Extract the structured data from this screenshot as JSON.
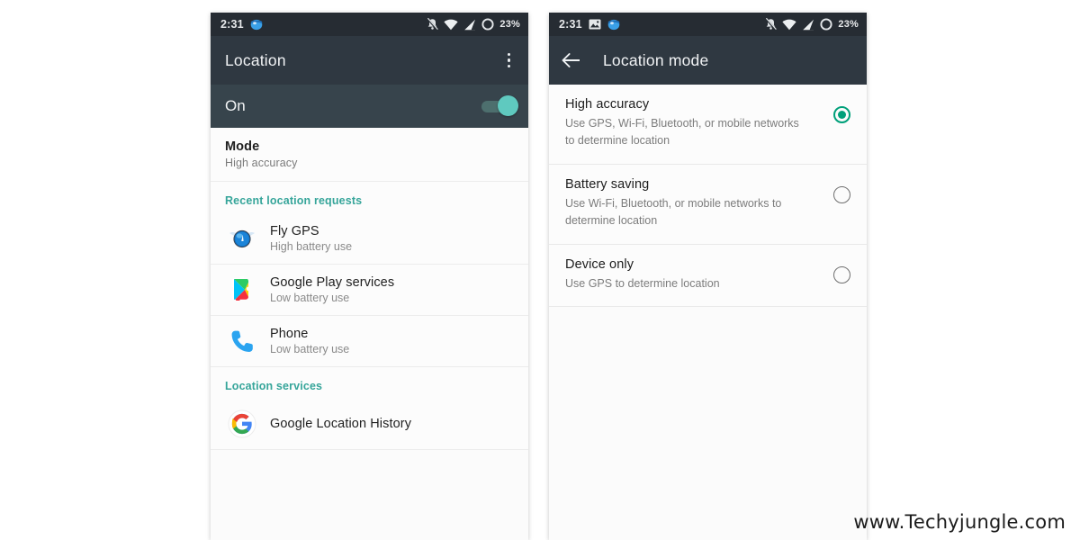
{
  "watermark": "www.Techyjungle.com",
  "left_phone": {
    "status_bar": {
      "time": "2:31",
      "battery_percent": "23%",
      "left_icons": [
        "app-notification-icon"
      ],
      "right_icons": [
        "notifications-off-icon",
        "wifi-icon",
        "signal-icon",
        "battery-icon"
      ]
    },
    "toolbar": {
      "title": "Location",
      "overflow_menu": "overflow-menu"
    },
    "master_switch": {
      "label": "On",
      "state": "on"
    },
    "mode_row": {
      "title": "Mode",
      "subtitle": "High accuracy"
    },
    "recent_section": {
      "header": "Recent location requests",
      "apps": [
        {
          "name": "Fly GPS",
          "battery": "High battery use",
          "icon": "fly-gps-icon"
        },
        {
          "name": "Google Play services",
          "battery": "Low battery use",
          "icon": "google-play-services-icon"
        },
        {
          "name": "Phone",
          "battery": "Low battery use",
          "icon": "phone-icon"
        }
      ]
    },
    "services_section": {
      "header": "Location services",
      "items": [
        {
          "name": "Google Location History",
          "icon": "google-icon"
        }
      ]
    }
  },
  "right_phone": {
    "status_bar": {
      "time": "2:31",
      "battery_percent": "23%",
      "left_icons": [
        "screenshot-icon",
        "app-notification-icon"
      ],
      "right_icons": [
        "notifications-off-icon",
        "wifi-icon",
        "signal-icon",
        "battery-icon"
      ]
    },
    "toolbar": {
      "back": "back-arrow",
      "title": "Location mode"
    },
    "options": [
      {
        "title": "High accuracy",
        "description": "Use GPS, Wi-Fi, Bluetooth, or mobile networks to determine location",
        "selected": true
      },
      {
        "title": "Battery saving",
        "description": "Use Wi-Fi, Bluetooth, or mobile networks to determine location",
        "selected": false
      },
      {
        "title": "Device only",
        "description": "Use GPS to determine location",
        "selected": false
      }
    ]
  },
  "colors": {
    "status_bar": "#262c33",
    "toolbar": "#2f3841",
    "switch_row": "#37444c",
    "accent_teal": "#36a59a",
    "radio_selected": "#00a07a",
    "toggle_thumb": "#5fc9bf"
  }
}
